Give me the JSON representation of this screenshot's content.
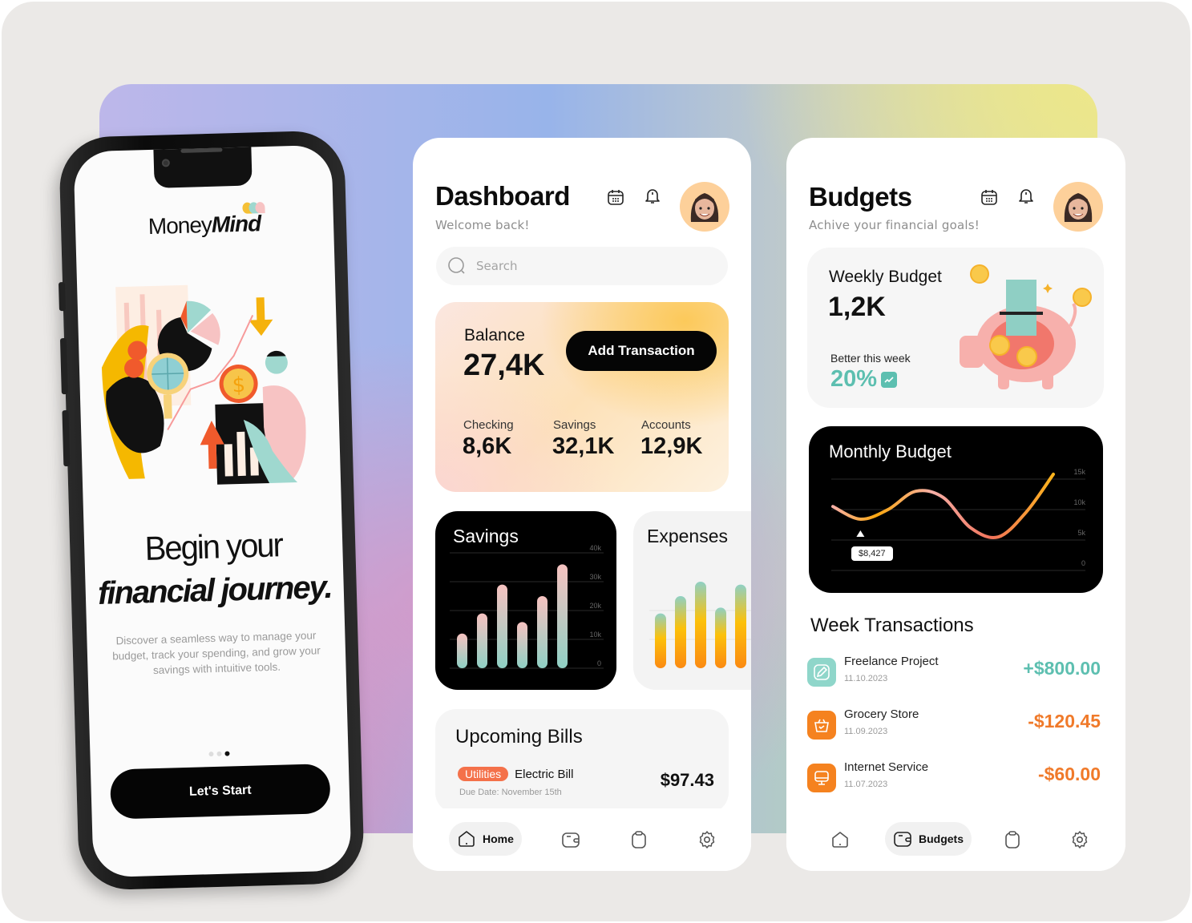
{
  "onboarding": {
    "logo_regular": "Money",
    "logo_bold": "Mind",
    "headline_line1": "Begin your",
    "headline_line2": "financial journey.",
    "description": "Discover a seamless way to manage your budget, track your spending, and grow your savings with intuitive tools.",
    "page_indicator": {
      "total": 3,
      "active": 3
    },
    "start_button": "Let's Start"
  },
  "dashboard": {
    "title": "Dashboard",
    "subtitle": "Welcome back!",
    "icons": [
      "calendar-icon",
      "bell-icon"
    ],
    "search": {
      "placeholder": "Search",
      "value": ""
    },
    "balance": {
      "label": "Balance",
      "value": "27,4K",
      "add_button": "Add Transaction",
      "accounts": [
        {
          "label": "Checking",
          "value": "8,6K"
        },
        {
          "label": "Savings",
          "value": "32,1K"
        },
        {
          "label": "Accounts",
          "value": "12,9K"
        }
      ]
    },
    "savings_title": "Savings",
    "expenses_title": "Expenses",
    "bills": {
      "title": "Upcoming Bills",
      "tag": "Utilities",
      "name": "Electric Bill",
      "due": "Due Date: November 15th",
      "amount": "$97.43"
    },
    "nav": [
      {
        "icon": "home-icon",
        "label": "Home",
        "active": true
      },
      {
        "icon": "wallet-icon",
        "label": "",
        "active": false
      },
      {
        "icon": "clipboard-icon",
        "label": "",
        "active": false
      },
      {
        "icon": "gear-icon",
        "label": "",
        "active": false
      }
    ]
  },
  "budgets": {
    "title": "Budgets",
    "subtitle": "Achive your financial goals!",
    "weekly": {
      "title": "Weekly Budget",
      "value": "1,2K",
      "trend_label": "Better this week",
      "trend_value": "20%"
    },
    "monthly_title": "Monthly Budget",
    "tooltip": "$8,427",
    "transactions_title": "Week Transactions",
    "transactions": [
      {
        "icon": "pencil-icon",
        "name": "Freelance Project",
        "date": "11.10.2023",
        "amount": "+$800.00",
        "color": "#5dbfb0",
        "icon_bg": "#8fd6ca"
      },
      {
        "icon": "basket-icon",
        "name": "Grocery Store",
        "date": "11.09.2023",
        "amount": "-$120.45",
        "color": "#f07a2a",
        "icon_bg": "#f5821f"
      },
      {
        "icon": "monitor-icon",
        "name": "Internet Service",
        "date": "11.07.2023",
        "amount": "-$60.00",
        "color": "#f07a2a",
        "icon_bg": "#f5821f"
      }
    ],
    "nav": [
      {
        "icon": "home-icon",
        "label": "",
        "active": false
      },
      {
        "icon": "wallet-icon",
        "label": "Budgets",
        "active": true
      },
      {
        "icon": "clipboard-icon",
        "label": "",
        "active": false
      },
      {
        "icon": "gear-icon",
        "label": "",
        "active": false
      }
    ]
  },
  "colors": {
    "accent_teal": "#5dbfb0",
    "accent_orange": "#f07a2a",
    "tag_red": "#f4714a",
    "avatar_bg": "#fdd09a"
  },
  "chart_data": [
    {
      "type": "bar",
      "title": "Savings",
      "categories": [
        "1",
        "2",
        "3",
        "4",
        "5",
        "6"
      ],
      "values": [
        12000,
        19000,
        29000,
        16000,
        25000,
        36000
      ],
      "ylim": [
        0,
        40000
      ],
      "yticks": [
        "40k",
        "30k",
        "20k",
        "10k",
        "0"
      ],
      "grid": true
    },
    {
      "type": "bar",
      "title": "Expenses",
      "categories": [
        "1",
        "2",
        "3",
        "4",
        "5"
      ],
      "values": [
        19000,
        25000,
        30000,
        21000,
        29000
      ],
      "ylim": [
        0,
        40000
      ],
      "grid": true
    },
    {
      "type": "line",
      "title": "Monthly Budget",
      "x": [
        0,
        1,
        2,
        3,
        4,
        5,
        6,
        7,
        8
      ],
      "values": [
        10500,
        8427,
        10000,
        13000,
        12000,
        7000,
        5500,
        9500,
        15800
      ],
      "ylim": [
        0,
        15000
      ],
      "yticks": [
        "15k",
        "10k",
        "5k",
        "0"
      ],
      "annotation": {
        "x": 1,
        "label": "$8,427"
      },
      "grid": true
    }
  ]
}
